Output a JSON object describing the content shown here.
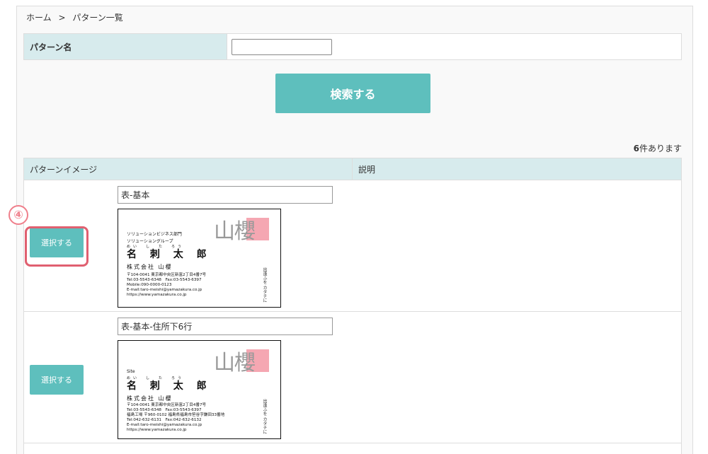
{
  "breadcrumb": {
    "home": "ホーム",
    "separator": ">",
    "current": "パターン一覧"
  },
  "search": {
    "label": "パターン名",
    "value": "",
    "button_label": "検索する"
  },
  "results": {
    "count": "6",
    "count_suffix": "件あります",
    "columns": [
      "パターンイメージ",
      "説明"
    ],
    "rows": [
      {
        "select_label": "選択する",
        "name": "表-基本",
        "card": {
          "logo": "山櫻",
          "dept1": "ソリューションビジネス部門",
          "dept2": "ソリューショングループ",
          "furigana": "めい　し　た　ろう",
          "name": "名 刺 太 郎",
          "company": "株式会社 山櫻",
          "address": [
            "〒104-0041 東京都中央区新富2丁目4番7号",
            "Tel:03-5543-6348　Fax:03-5543-6397",
            "Mobile:090-0000-0123",
            "E-mail:taro-meishi@yamazakura.co.jp",
            "https://www.yamazakura.co.jp"
          ],
          "vertical": "出逢ふを カタチに"
        }
      },
      {
        "select_label": "選択する",
        "name": "表-基本-住所下6行",
        "card": {
          "logo": "山櫻",
          "dept1": "Site",
          "furigana": "めい　し　た　ろう",
          "name": "名 刺 太 郎",
          "company": "株式会社 山櫻",
          "address": [
            "〒104-0041 東京都中央区新富2丁目4番7号",
            "Tel:03-5543-6348　Fax:03-5543-6397",
            "福島工場 〒960-0102 福島県福島市笹谷字鎌田33番地",
            "Tel:042-632-6131　Fax:042-632-6132",
            "E-mail:taro-meishi@yamazakura.co.jp",
            "https://www.yamazakura.co.jp"
          ],
          "vertical": "出逢ふを カタチに"
        }
      }
    ]
  },
  "annotation": {
    "step_number": "④"
  },
  "colors": {
    "accent": "#5ebfbd",
    "header_bg": "#d7ebed",
    "highlight": "#e06070",
    "card_mark": "#f5a7b2"
  }
}
